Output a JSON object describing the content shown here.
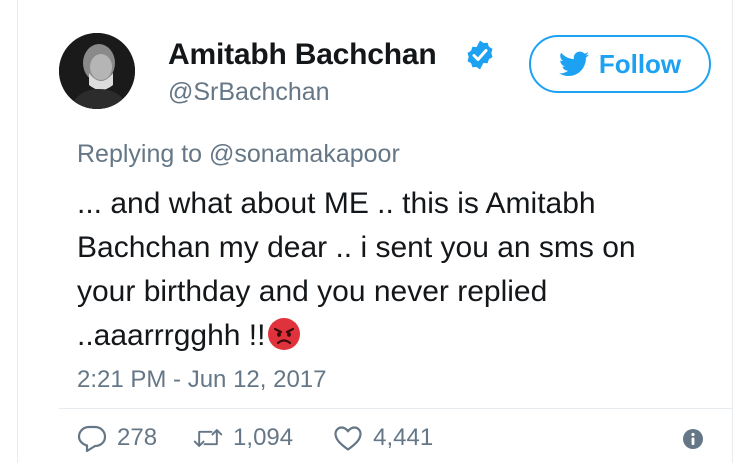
{
  "author": {
    "display_name": "Amitabh Bachchan",
    "handle": "@SrBachchan",
    "verified": true
  },
  "follow_button": {
    "label": "Follow"
  },
  "tweet": {
    "replying_to": "Replying to @sonamakapoor",
    "text_lines": [
      "... and what about ME .. this is Amitabh",
      "Bachchan my dear .. i sent you an sms on",
      "your birthday and you never replied",
      "..aaarrrgghh !!"
    ],
    "emoji": "angry-face",
    "timestamp": "2:21 PM - Jun 12, 2017"
  },
  "stats": {
    "replies": "278",
    "retweets": "1,094",
    "likes": "4,441"
  },
  "colors": {
    "accent": "#1da1f2",
    "secondary_text": "#657786",
    "emoji_red": "#e0323c"
  },
  "icons": {
    "verified": "verified-badge-icon",
    "follow": "twitter-bird-icon",
    "reply": "reply-icon",
    "retweet": "retweet-icon",
    "like": "heart-icon",
    "info": "info-icon"
  }
}
